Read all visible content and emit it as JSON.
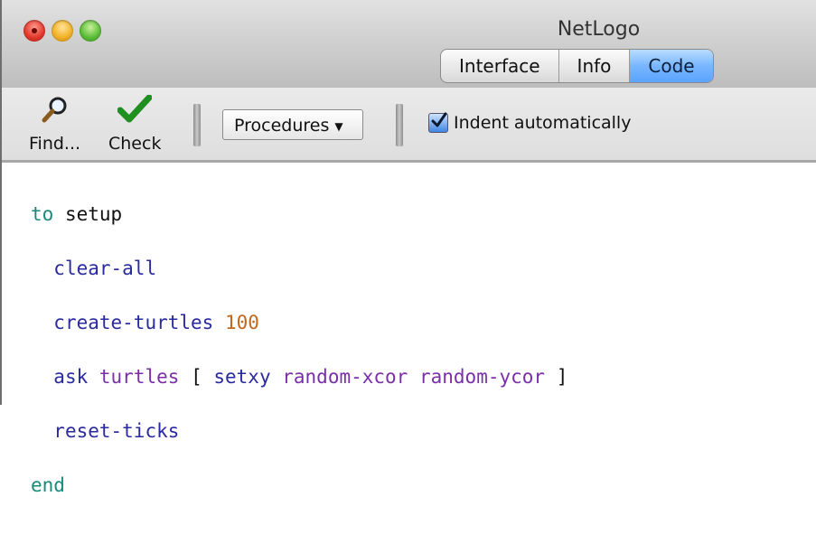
{
  "window": {
    "title": "NetLogo",
    "tabs": [
      "Interface",
      "Info",
      "Code"
    ],
    "active_tab": "Code"
  },
  "toolbar": {
    "find_label": "Find...",
    "check_label": "Check",
    "procedures_label": "Procedures",
    "indent_label": "Indent automatically",
    "indent_checked": true
  },
  "code": {
    "line1": {
      "keyword": "to",
      "name": "setup"
    },
    "line2": {
      "cmd": "clear-all"
    },
    "line3": {
      "cmd": "create-turtles",
      "num": "100"
    },
    "line4": {
      "cmd": "ask",
      "rep1": "turtles",
      "open": "[",
      "cmd2": "setxy",
      "rep2": "random-xcor",
      "rep3": "random-ycor",
      "close": "]"
    },
    "line5": {
      "cmd": "reset-ticks"
    },
    "line6": {
      "keyword": "end"
    }
  },
  "colors": {
    "keyword": "#1a8a7a",
    "command": "#2a2aa0",
    "reporter": "#7a2fa8",
    "number": "#c2671c",
    "active_tab": "#79b6ff"
  }
}
